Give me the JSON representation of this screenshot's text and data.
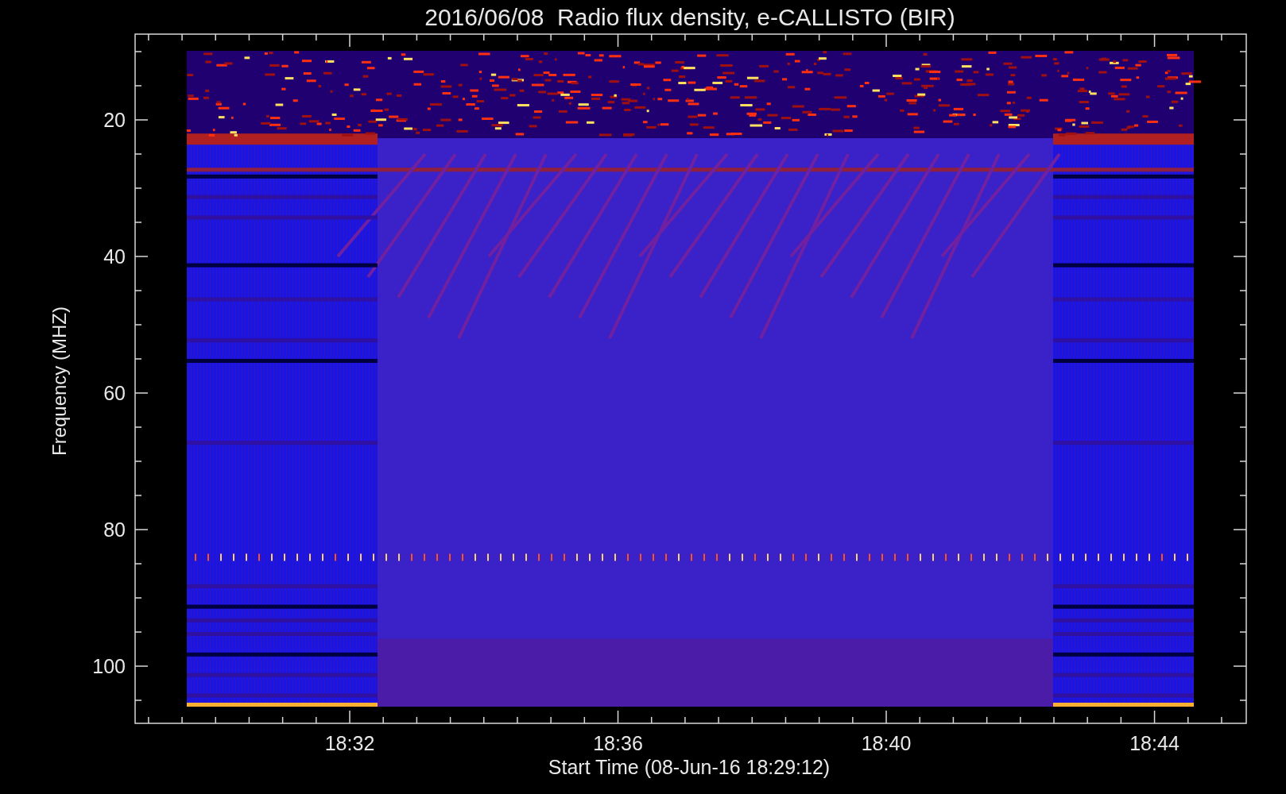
{
  "title": "2016/06/08  Radio flux density, e-CALLISTO (BIR)",
  "y_axis": {
    "label": "Frequency (MHZ)",
    "ticks": [
      "20",
      "40",
      "60",
      "80",
      "100"
    ]
  },
  "x_axis": {
    "label": "Start Time (08-Jun-16 18:29:12)",
    "ticks": [
      "18:32",
      "18:36",
      "18:40",
      "18:44"
    ]
  }
}
